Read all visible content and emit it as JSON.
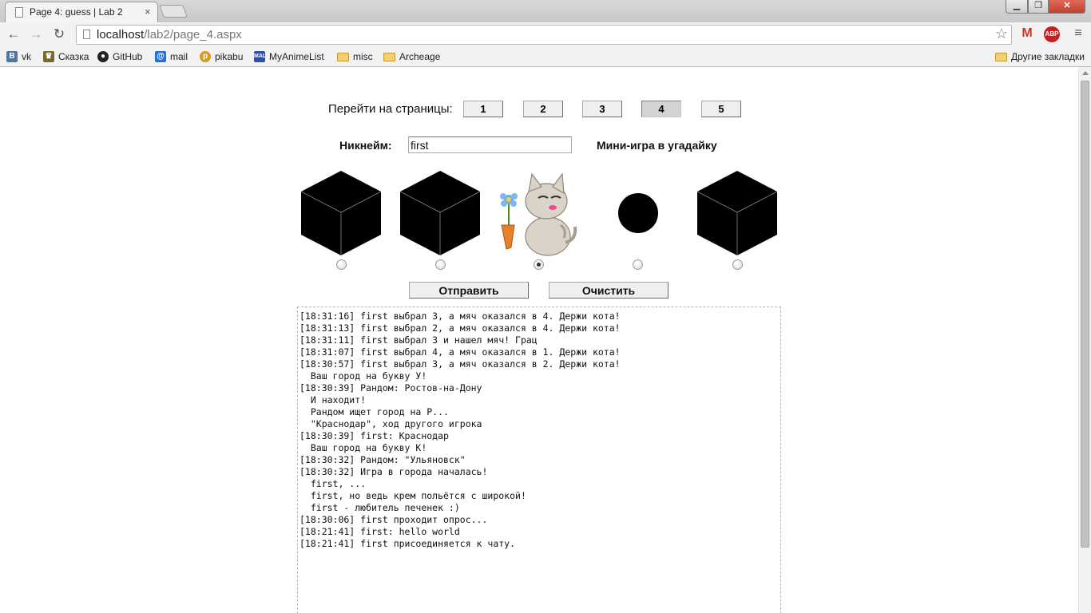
{
  "browser": {
    "tab_title": "Page 4: guess | Lab 2",
    "tab_close": "×",
    "url_host": "localhost",
    "url_path": "/lab2/page_4.aspx",
    "ext_gmail": "M",
    "ext_abp": "ABP",
    "bookmarks": [
      "vk",
      "Сказка",
      "GitHub",
      "mail",
      "pikabu",
      "MyAnimeList",
      "misc",
      "Archeage"
    ],
    "other_bookmarks": "Другие закладки"
  },
  "nav": {
    "goto_label": "Перейти на страницы:",
    "pages": [
      "1",
      "2",
      "3",
      "4",
      "5"
    ],
    "active_page": "4"
  },
  "form": {
    "nickname_label": "Никнейм:",
    "nickname_value": "first",
    "game_title": "Мини-игра в угадайку"
  },
  "game": {
    "cells": [
      "cube",
      "cube",
      "cat",
      "ball",
      "cube"
    ],
    "selected_index": 2
  },
  "buttons": {
    "submit": "Отправить",
    "clear": "Очистить"
  },
  "chat": [
    "[18:31:16] first выбрал 3, а мяч оказался в 4. Держи кота!",
    "[18:31:13] first выбрал 2, а мяч оказался в 4. Держи кота!",
    "[18:31:11] first выбрал 3 и нашел мяч! Грац",
    "[18:31:07] first выбрал 4, а мяч оказался в 1. Держи кота!",
    "[18:30:57] first выбрал 3, а мяч оказался в 2. Держи кота!",
    "  Ваш город на букву У!",
    "[18:30:39] Рандом: Ростов-на-Дону",
    "  И находит!",
    "  Рандом ищет город на Р...",
    "  \"Краснодар\", ход другого игрока",
    "[18:30:39] first: Краснодар",
    "  Ваш город на букву К!",
    "[18:30:32] Рандом: \"Ульяновск\"",
    "[18:30:32] Игра в города началась!",
    "  first, ...",
    "  first, но ведь крем польётся с широкой!",
    "  first - любитель печенек :)",
    "[18:30:06] first проходит опрос...",
    "[18:21:41] first: hello world",
    "[18:21:41] first присоединяется к чату."
  ]
}
